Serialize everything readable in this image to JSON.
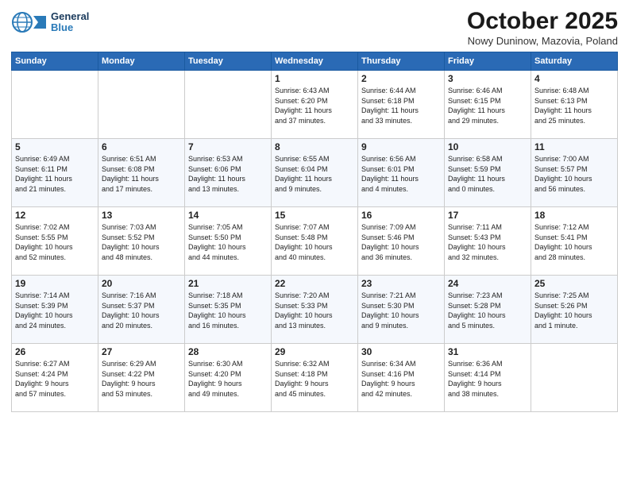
{
  "logo": {
    "line1": "General",
    "line2": "Blue"
  },
  "title": "October 2025",
  "subtitle": "Nowy Duninow, Mazovia, Poland",
  "days_of_week": [
    "Sunday",
    "Monday",
    "Tuesday",
    "Wednesday",
    "Thursday",
    "Friday",
    "Saturday"
  ],
  "weeks": [
    [
      {
        "day": "",
        "info": ""
      },
      {
        "day": "",
        "info": ""
      },
      {
        "day": "",
        "info": ""
      },
      {
        "day": "1",
        "info": "Sunrise: 6:43 AM\nSunset: 6:20 PM\nDaylight: 11 hours\nand 37 minutes."
      },
      {
        "day": "2",
        "info": "Sunrise: 6:44 AM\nSunset: 6:18 PM\nDaylight: 11 hours\nand 33 minutes."
      },
      {
        "day": "3",
        "info": "Sunrise: 6:46 AM\nSunset: 6:15 PM\nDaylight: 11 hours\nand 29 minutes."
      },
      {
        "day": "4",
        "info": "Sunrise: 6:48 AM\nSunset: 6:13 PM\nDaylight: 11 hours\nand 25 minutes."
      }
    ],
    [
      {
        "day": "5",
        "info": "Sunrise: 6:49 AM\nSunset: 6:11 PM\nDaylight: 11 hours\nand 21 minutes."
      },
      {
        "day": "6",
        "info": "Sunrise: 6:51 AM\nSunset: 6:08 PM\nDaylight: 11 hours\nand 17 minutes."
      },
      {
        "day": "7",
        "info": "Sunrise: 6:53 AM\nSunset: 6:06 PM\nDaylight: 11 hours\nand 13 minutes."
      },
      {
        "day": "8",
        "info": "Sunrise: 6:55 AM\nSunset: 6:04 PM\nDaylight: 11 hours\nand 9 minutes."
      },
      {
        "day": "9",
        "info": "Sunrise: 6:56 AM\nSunset: 6:01 PM\nDaylight: 11 hours\nand 4 minutes."
      },
      {
        "day": "10",
        "info": "Sunrise: 6:58 AM\nSunset: 5:59 PM\nDaylight: 11 hours\nand 0 minutes."
      },
      {
        "day": "11",
        "info": "Sunrise: 7:00 AM\nSunset: 5:57 PM\nDaylight: 10 hours\nand 56 minutes."
      }
    ],
    [
      {
        "day": "12",
        "info": "Sunrise: 7:02 AM\nSunset: 5:55 PM\nDaylight: 10 hours\nand 52 minutes."
      },
      {
        "day": "13",
        "info": "Sunrise: 7:03 AM\nSunset: 5:52 PM\nDaylight: 10 hours\nand 48 minutes."
      },
      {
        "day": "14",
        "info": "Sunrise: 7:05 AM\nSunset: 5:50 PM\nDaylight: 10 hours\nand 44 minutes."
      },
      {
        "day": "15",
        "info": "Sunrise: 7:07 AM\nSunset: 5:48 PM\nDaylight: 10 hours\nand 40 minutes."
      },
      {
        "day": "16",
        "info": "Sunrise: 7:09 AM\nSunset: 5:46 PM\nDaylight: 10 hours\nand 36 minutes."
      },
      {
        "day": "17",
        "info": "Sunrise: 7:11 AM\nSunset: 5:43 PM\nDaylight: 10 hours\nand 32 minutes."
      },
      {
        "day": "18",
        "info": "Sunrise: 7:12 AM\nSunset: 5:41 PM\nDaylight: 10 hours\nand 28 minutes."
      }
    ],
    [
      {
        "day": "19",
        "info": "Sunrise: 7:14 AM\nSunset: 5:39 PM\nDaylight: 10 hours\nand 24 minutes."
      },
      {
        "day": "20",
        "info": "Sunrise: 7:16 AM\nSunset: 5:37 PM\nDaylight: 10 hours\nand 20 minutes."
      },
      {
        "day": "21",
        "info": "Sunrise: 7:18 AM\nSunset: 5:35 PM\nDaylight: 10 hours\nand 16 minutes."
      },
      {
        "day": "22",
        "info": "Sunrise: 7:20 AM\nSunset: 5:33 PM\nDaylight: 10 hours\nand 13 minutes."
      },
      {
        "day": "23",
        "info": "Sunrise: 7:21 AM\nSunset: 5:30 PM\nDaylight: 10 hours\nand 9 minutes."
      },
      {
        "day": "24",
        "info": "Sunrise: 7:23 AM\nSunset: 5:28 PM\nDaylight: 10 hours\nand 5 minutes."
      },
      {
        "day": "25",
        "info": "Sunrise: 7:25 AM\nSunset: 5:26 PM\nDaylight: 10 hours\nand 1 minute."
      }
    ],
    [
      {
        "day": "26",
        "info": "Sunrise: 6:27 AM\nSunset: 4:24 PM\nDaylight: 9 hours\nand 57 minutes."
      },
      {
        "day": "27",
        "info": "Sunrise: 6:29 AM\nSunset: 4:22 PM\nDaylight: 9 hours\nand 53 minutes."
      },
      {
        "day": "28",
        "info": "Sunrise: 6:30 AM\nSunset: 4:20 PM\nDaylight: 9 hours\nand 49 minutes."
      },
      {
        "day": "29",
        "info": "Sunrise: 6:32 AM\nSunset: 4:18 PM\nDaylight: 9 hours\nand 45 minutes."
      },
      {
        "day": "30",
        "info": "Sunrise: 6:34 AM\nSunset: 4:16 PM\nDaylight: 9 hours\nand 42 minutes."
      },
      {
        "day": "31",
        "info": "Sunrise: 6:36 AM\nSunset: 4:14 PM\nDaylight: 9 hours\nand 38 minutes."
      },
      {
        "day": "",
        "info": ""
      }
    ]
  ]
}
